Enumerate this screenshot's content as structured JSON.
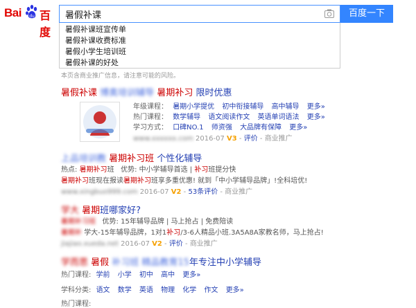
{
  "logo": {
    "bai": "Bai",
    "du": "百度"
  },
  "search": {
    "query": "暑假补课",
    "button": "百度一下"
  },
  "suggestions": [
    "暑假补课班宣传单",
    "暑假补课收费标准",
    "暑假小学生培训班",
    "暑假补课的好处"
  ],
  "note": "本页含商业推广信息，请注意可能的风险。",
  "r1": {
    "title_a": "暑假补课",
    "title_b": "暑期补习",
    "title_c": "限时优惠",
    "grade_label": "年级课程：",
    "grade_links": [
      "暑期小学提优",
      "初中衔接辅导",
      "高中辅导",
      "更多»"
    ],
    "hot_label": "热门课程：",
    "hot_links": [
      "数学辅导",
      "语文阅读作文",
      "英语单词语法",
      "更多»"
    ],
    "mode_label": "学习方式：",
    "mode_links": [
      "口碑NO.1",
      "师资强",
      "大品牌有保障",
      "更多»"
    ],
    "date": "2016-07",
    "v": "V3",
    "eval": "评价",
    "ad": "商业推广"
  },
  "r2": {
    "title_a": "暑期补习班",
    "title_b": "个性化辅导",
    "line1_label": "热点:",
    "line1_hl": "暑期补习",
    "line1_text": "班",
    "line1_adv": "优势: 中小学辅导首选",
    "line1_hl2": "补习",
    "line1_tail": "班提分快",
    "line2_hl": "暑期补习",
    "line2_a": "班现在报读",
    "line2_hl2": "暑期补习",
    "line2_b": "班享多重优惠! 就到「中小学辅导品牌」!全科培优!",
    "date": "2016-07",
    "v": "V2",
    "eval": "53条评价",
    "ad": "商业推广"
  },
  "r3": {
    "title_a": "暑期",
    "title_b": "班哪家好?",
    "line1_adv": "优势: 15年辅导品牌 | 马上抢占 | 免费陪读",
    "line2_a": "学大-15年辅导品牌，1对1",
    "line2_hl": "补习",
    "line2_b": "/3-6人精品小班.3A5A8A家教名师，马上抢占!",
    "date": "2016-07",
    "v": "V2",
    "eval": "评价",
    "ad": "商业推广"
  },
  "r4": {
    "title_a": "暑假",
    "title_b": "年专注中小学辅导",
    "pre_label": "热门课程:",
    "pre_links": [
      "学前",
      "小学",
      "初中",
      "高中",
      "更多»"
    ],
    "subj_label": "学科分类:",
    "subj_links": [
      "语文",
      "数学",
      "英语",
      "物理",
      "化学",
      "作文",
      "更多»"
    ],
    "last_label": "热门课程:"
  },
  "colors": {
    "brand_red": "#e10602",
    "link_blue": "#2440b3",
    "button_blue": "#3385ff",
    "green": "#008000"
  }
}
